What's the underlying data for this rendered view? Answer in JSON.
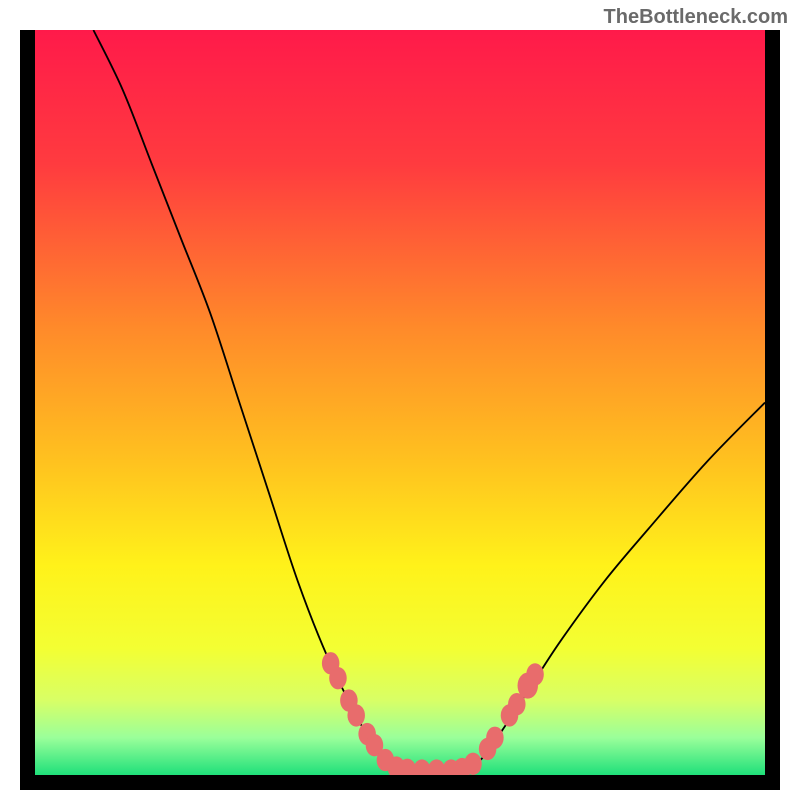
{
  "watermark": "TheBottleneck.com",
  "chart_data": {
    "type": "line",
    "title": "",
    "xlabel": "",
    "ylabel": "",
    "xlim": [
      0,
      100
    ],
    "ylim": [
      0,
      100
    ],
    "gradient_stops": [
      {
        "offset": 0,
        "color": "#ff1a4a"
      },
      {
        "offset": 18,
        "color": "#ff3b3f"
      },
      {
        "offset": 40,
        "color": "#ff8a2a"
      },
      {
        "offset": 58,
        "color": "#ffc21f"
      },
      {
        "offset": 72,
        "color": "#fff21a"
      },
      {
        "offset": 83,
        "color": "#f3ff33"
      },
      {
        "offset": 90,
        "color": "#d8ff66"
      },
      {
        "offset": 95,
        "color": "#9aff9a"
      },
      {
        "offset": 100,
        "color": "#1fe07a"
      }
    ],
    "series": [
      {
        "name": "bottleneck-curve",
        "color": "#000000",
        "points": [
          {
            "x": 8,
            "y": 100
          },
          {
            "x": 12,
            "y": 92
          },
          {
            "x": 16,
            "y": 82
          },
          {
            "x": 20,
            "y": 72
          },
          {
            "x": 24,
            "y": 62
          },
          {
            "x": 28,
            "y": 50
          },
          {
            "x": 32,
            "y": 38
          },
          {
            "x": 36,
            "y": 26
          },
          {
            "x": 40,
            "y": 16
          },
          {
            "x": 44,
            "y": 8
          },
          {
            "x": 47,
            "y": 3
          },
          {
            "x": 50,
            "y": 0.5
          },
          {
            "x": 54,
            "y": 0.5
          },
          {
            "x": 58,
            "y": 0.5
          },
          {
            "x": 61,
            "y": 2
          },
          {
            "x": 64,
            "y": 6
          },
          {
            "x": 68,
            "y": 12
          },
          {
            "x": 72,
            "y": 18
          },
          {
            "x": 78,
            "y": 26
          },
          {
            "x": 84,
            "y": 33
          },
          {
            "x": 92,
            "y": 42
          },
          {
            "x": 100,
            "y": 50
          }
        ]
      }
    ],
    "markers": [
      {
        "x": 40.5,
        "y": 15,
        "r": 1.2
      },
      {
        "x": 41.5,
        "y": 13,
        "r": 1.2
      },
      {
        "x": 43,
        "y": 10,
        "r": 1.2
      },
      {
        "x": 44,
        "y": 8,
        "r": 1.2
      },
      {
        "x": 45.5,
        "y": 5.5,
        "r": 1.2
      },
      {
        "x": 46.5,
        "y": 4,
        "r": 1.2
      },
      {
        "x": 48,
        "y": 2,
        "r": 1.2
      },
      {
        "x": 49.5,
        "y": 1,
        "r": 1.2
      },
      {
        "x": 51,
        "y": 0.7,
        "r": 1.2
      },
      {
        "x": 53,
        "y": 0.6,
        "r": 1.2
      },
      {
        "x": 55,
        "y": 0.6,
        "r": 1.2
      },
      {
        "x": 57,
        "y": 0.6,
        "r": 1.2
      },
      {
        "x": 58.5,
        "y": 0.8,
        "r": 1.2
      },
      {
        "x": 60,
        "y": 1.5,
        "r": 1.2
      },
      {
        "x": 62,
        "y": 3.5,
        "r": 1.2
      },
      {
        "x": 63,
        "y": 5,
        "r": 1.2
      },
      {
        "x": 65,
        "y": 8,
        "r": 1.2
      },
      {
        "x": 66,
        "y": 9.5,
        "r": 1.2
      },
      {
        "x": 67.5,
        "y": 12,
        "r": 1.4
      },
      {
        "x": 68.5,
        "y": 13.5,
        "r": 1.2
      }
    ],
    "marker_color": "#e86c6c"
  }
}
